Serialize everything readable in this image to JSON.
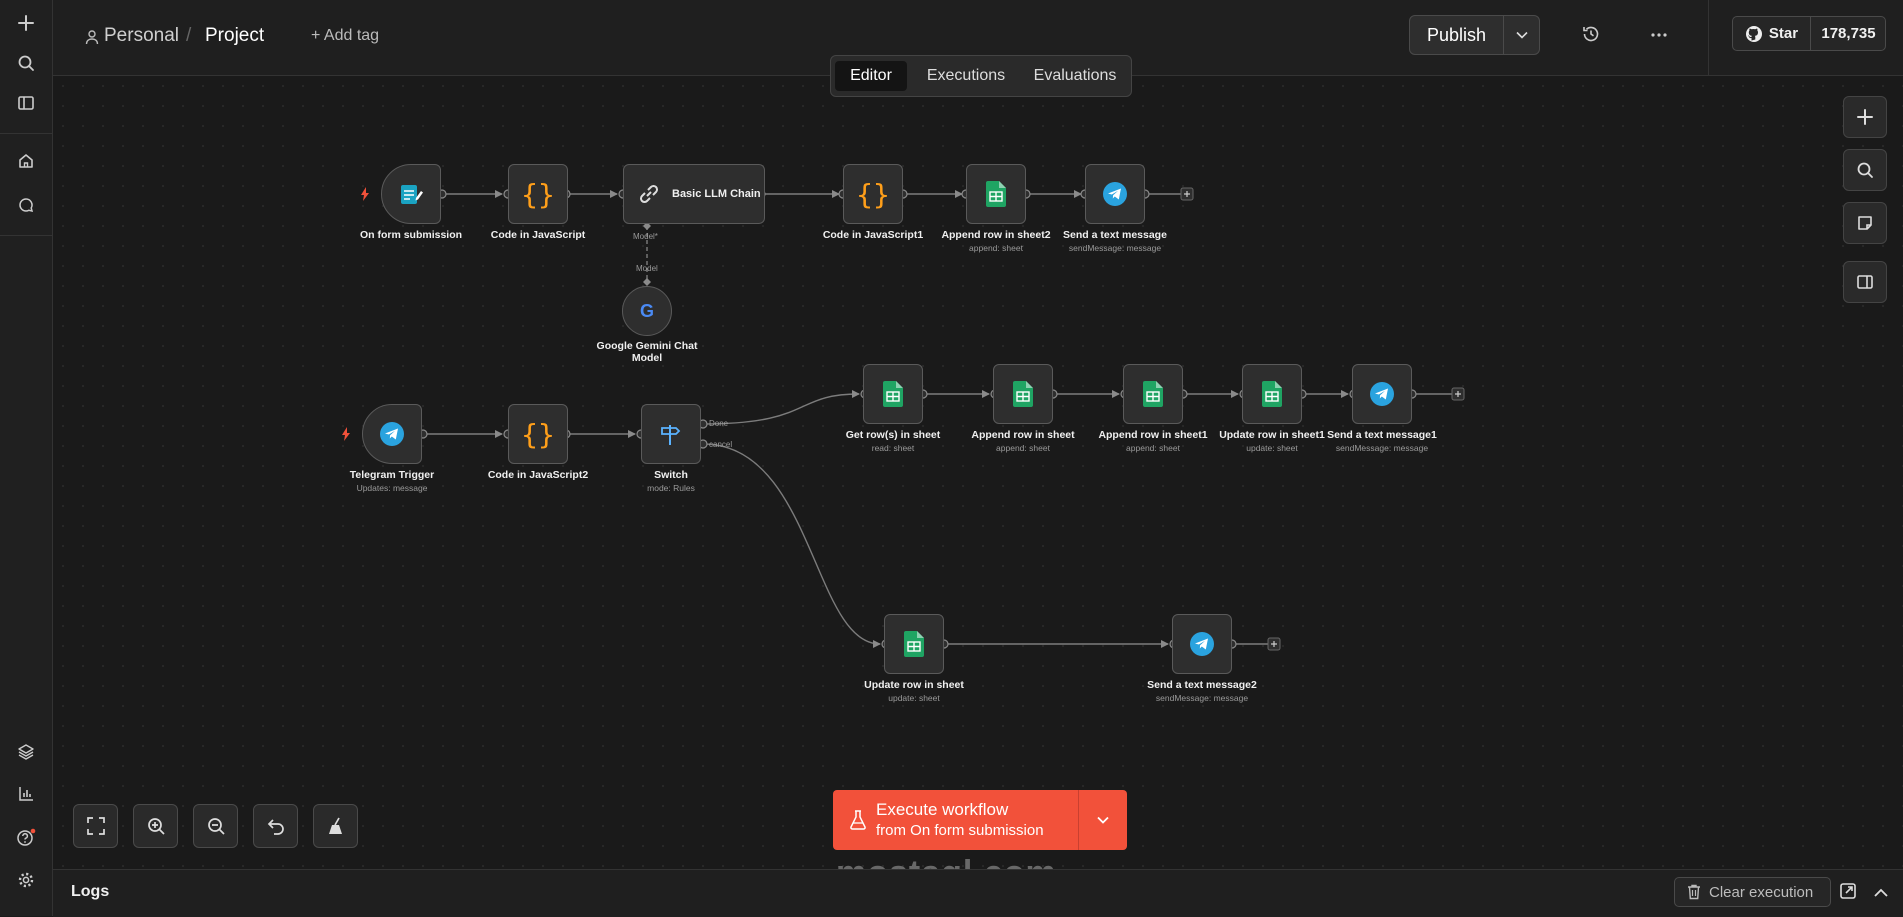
{
  "breadcrumb": {
    "owner": "Personal",
    "separator": "/",
    "project": "Project",
    "add_tag": "+ Add tag"
  },
  "header": {
    "publish_label": "Publish",
    "star_label": "Star",
    "star_count": "178,735"
  },
  "tabs": [
    {
      "label": "Editor",
      "active": true
    },
    {
      "label": "Executions",
      "active": false
    },
    {
      "label": "Evaluations",
      "active": false
    }
  ],
  "nodes": {
    "form_submission": {
      "label": "On form submission"
    },
    "code_js": {
      "label": "Code in JavaScript"
    },
    "llm_chain": {
      "label": "Basic LLM Chain",
      "port_top": "Model*",
      "port_bottom": "Model"
    },
    "code_js1": {
      "label": "Code in JavaScript1"
    },
    "append_sheet2": {
      "label": "Append row in sheet2",
      "sub": "append: sheet"
    },
    "send_msg": {
      "label": "Send a text message",
      "sub": "sendMessage: message"
    },
    "gemini": {
      "label": "Google Gemini Chat",
      "label2": "Model"
    },
    "telegram_trigger": {
      "label": "Telegram Trigger",
      "sub": "Updates: message"
    },
    "code_js2": {
      "label": "Code in JavaScript2"
    },
    "switch": {
      "label": "Switch",
      "sub": "mode: Rules",
      "out_done": "Done",
      "out_cancel": "cancel"
    },
    "get_rows": {
      "label": "Get row(s) in sheet",
      "sub": "read: sheet"
    },
    "append_sheet": {
      "label": "Append row in sheet",
      "sub": "append: sheet"
    },
    "append_sheet1": {
      "label": "Append row in sheet1",
      "sub": "append: sheet"
    },
    "update_sheet1": {
      "label": "Update row in sheet1",
      "sub": "update: sheet"
    },
    "send_msg1": {
      "label": "Send a text message1",
      "sub": "sendMessage: message"
    },
    "update_sheet": {
      "label": "Update row in sheet",
      "sub": "update: sheet"
    },
    "send_msg2": {
      "label": "Send a text message2",
      "sub": "sendMessage: message"
    }
  },
  "execute": {
    "title": "Execute workflow",
    "subtitle": "from On form submission",
    "color": "#f2513a"
  },
  "watermark": "mostaql.com",
  "logs": {
    "label": "Logs",
    "clear_label": "Clear execution"
  },
  "colors": {
    "accent": "#f2513a",
    "sheets": "#1fa463",
    "telegram": "#2aa3df",
    "code": "#ff9f1a"
  }
}
